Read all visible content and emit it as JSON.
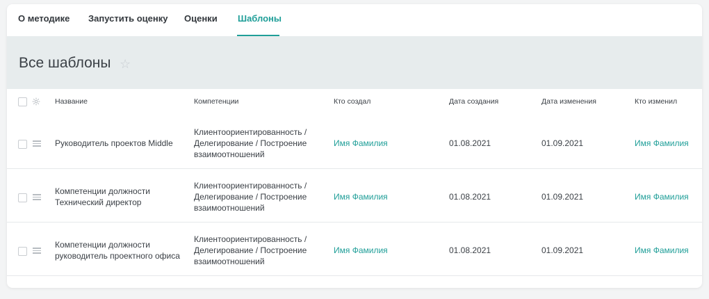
{
  "tabs": [
    {
      "label": "О методике"
    },
    {
      "label": "Запустить оценку"
    },
    {
      "label": "Оценки"
    },
    {
      "label": "Шаблоны"
    }
  ],
  "active_tab": "Шаблоны",
  "page": {
    "title": "Все шаблоны"
  },
  "table": {
    "columns": [
      "Название",
      "Компетенции",
      "Кто создал",
      "Дата создания",
      "Дата изменения",
      "Кто изменил"
    ],
    "rows": [
      {
        "name_lines": [
          "Руководитель проектов Middle"
        ],
        "competencies_lines": [
          "Клиентоориентированность /",
          "Делегирование / Построение",
          "взаимоотношений"
        ],
        "created_by": "Имя Фамилия",
        "created_at": "01.08.2021",
        "modified_at": "01.09.2021",
        "modified_by": "Имя Фамилия"
      },
      {
        "name_lines": [
          "Компетенции должности",
          "Технический директор"
        ],
        "competencies_lines": [
          "Клиентоориентированность /",
          "Делегирование / Построение",
          "взаимоотношений"
        ],
        "created_by": "Имя Фамилия",
        "created_at": "01.08.2021",
        "modified_at": "01.09.2021",
        "modified_by": "Имя Фамилия"
      },
      {
        "name_lines": [
          "Компетенции должности",
          "руководитель проектного офиса"
        ],
        "competencies_lines": [
          "Клиентоориентированность /",
          "Делегирование / Построение",
          "взаимоотношений"
        ],
        "created_by": "Имя Фамилия",
        "created_at": "01.08.2021",
        "modified_at": "01.09.2021",
        "modified_by": "Имя Фамилия"
      }
    ]
  },
  "colors": {
    "accent": "#1f9e98",
    "hero_bg": "#e7eced",
    "text": "#3a3f45"
  },
  "icons": {
    "favorite": "star-outline-icon",
    "settings": "gear-icon",
    "drag": "drag-handle-icon"
  }
}
